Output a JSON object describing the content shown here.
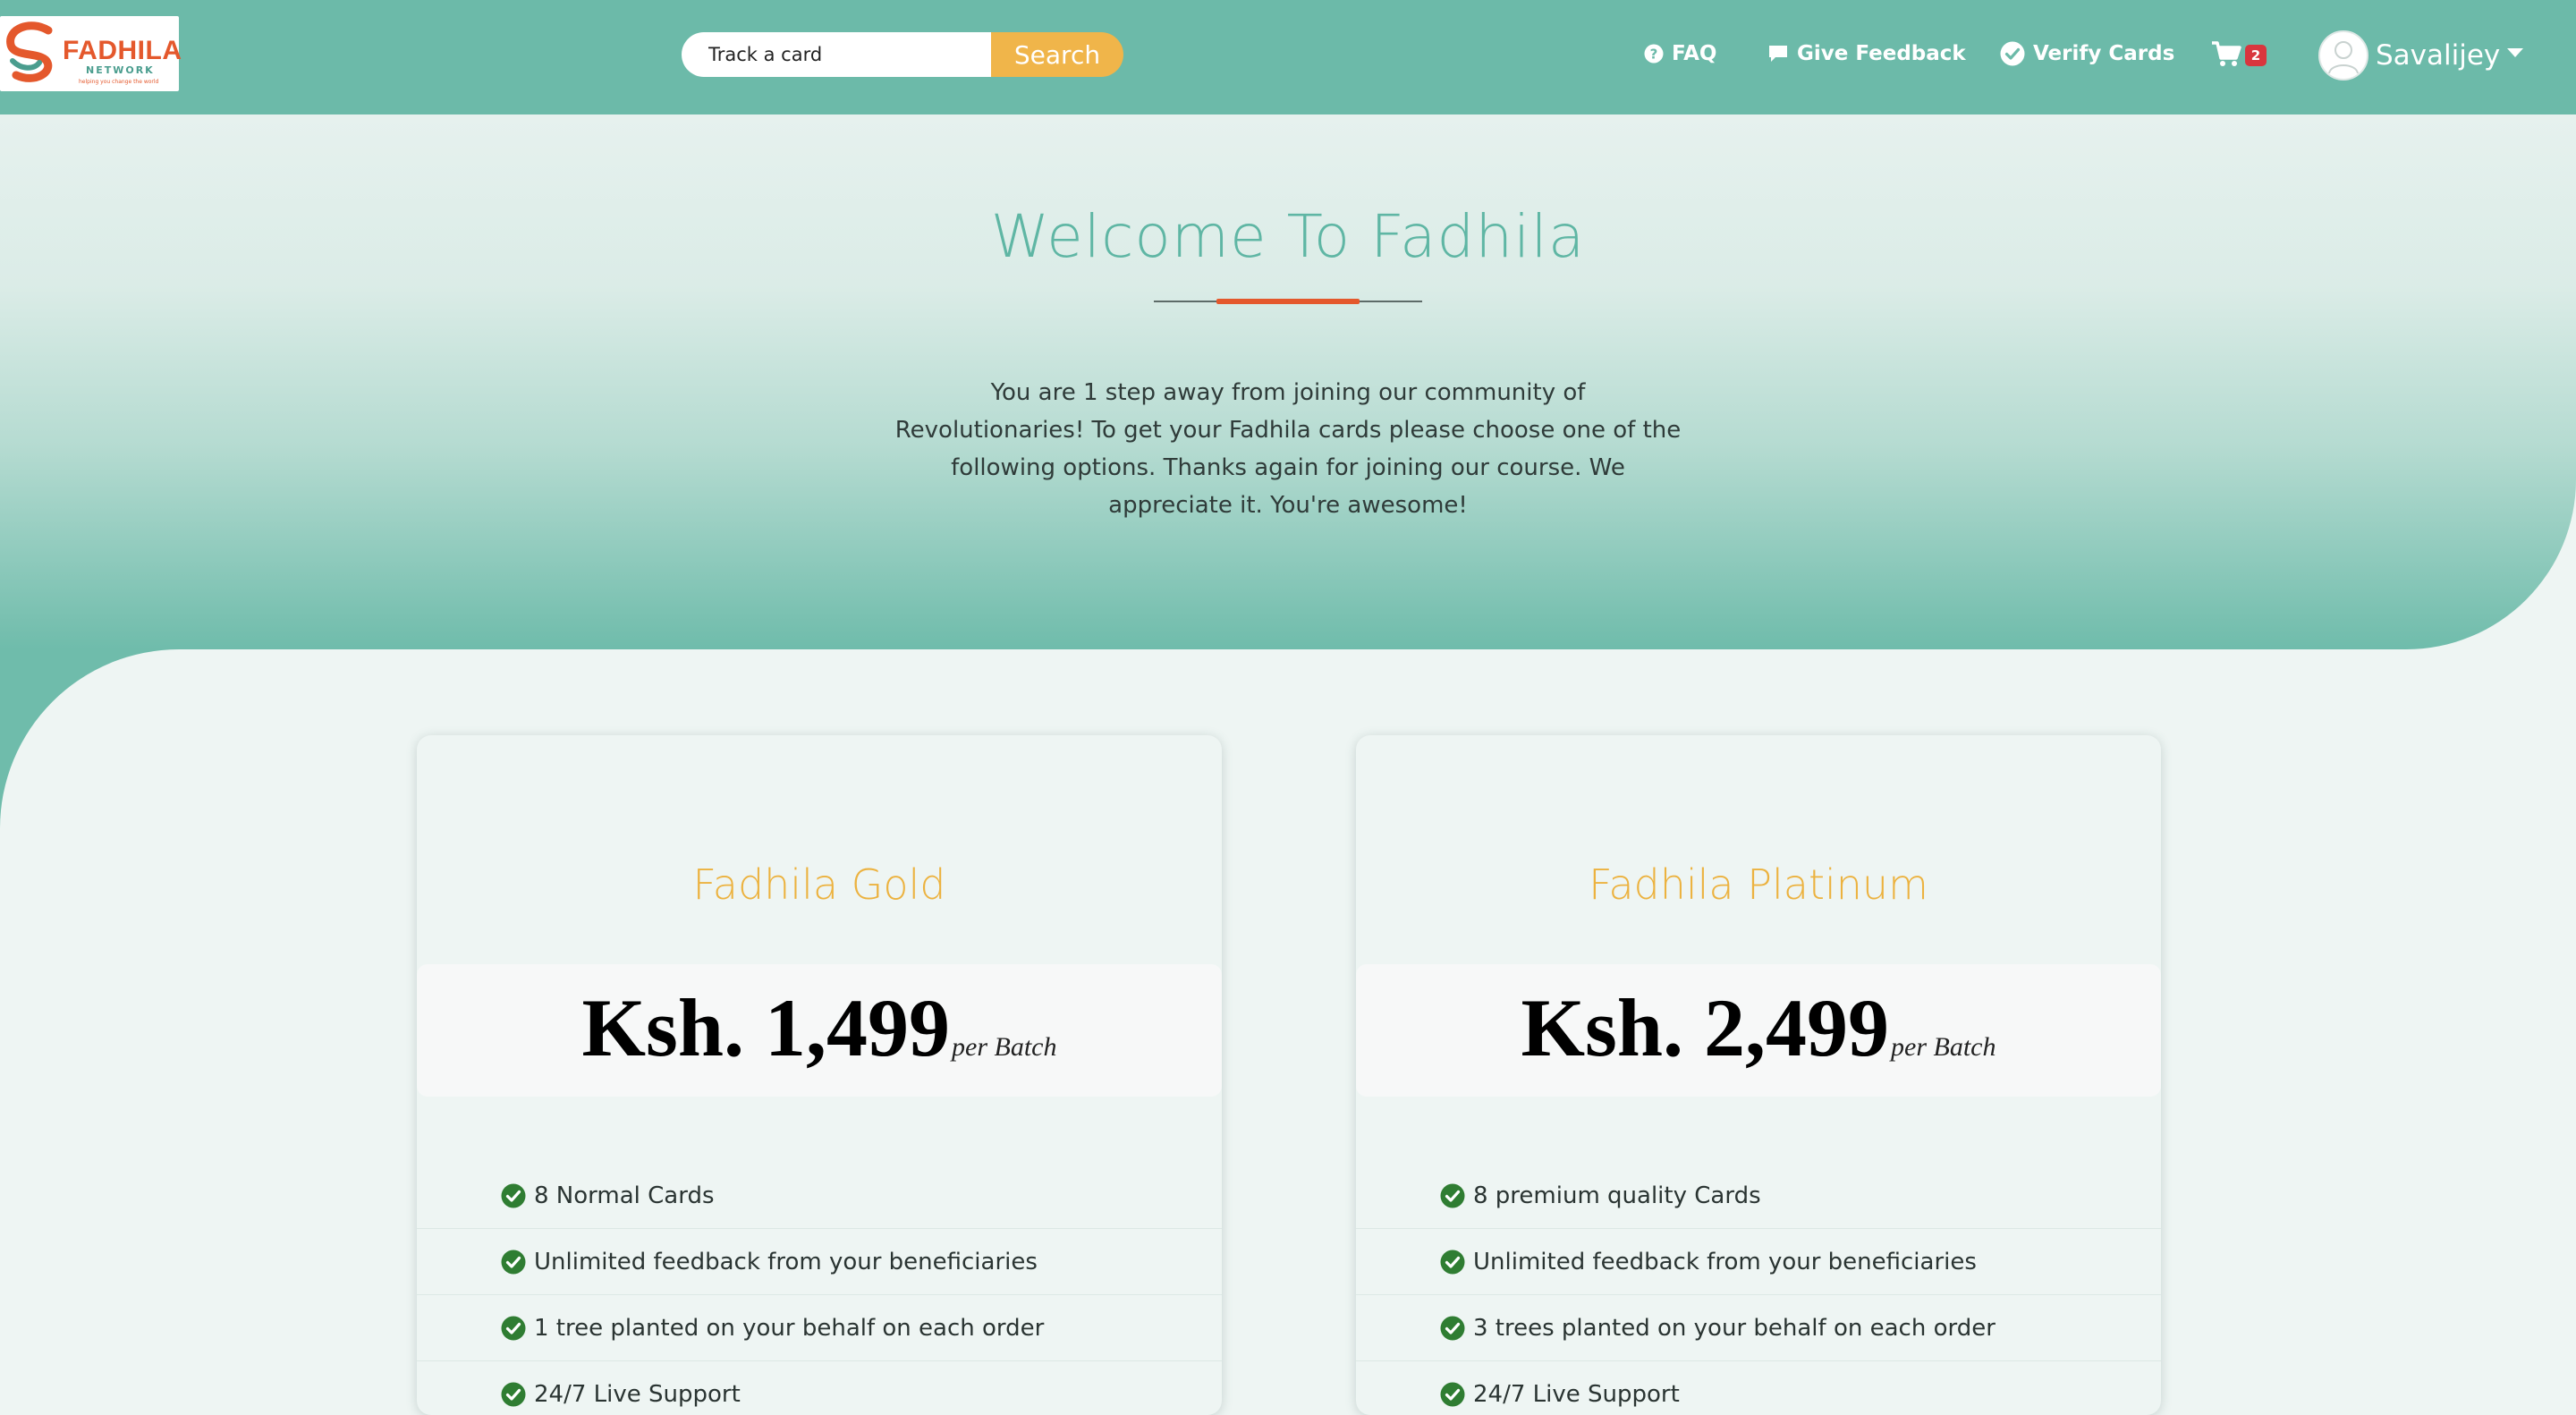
{
  "navbar": {
    "logo": {
      "word": "FADHILA",
      "sub": "NETWORK",
      "tagline": "helping you change the world"
    },
    "search": {
      "placeholder": "Track a card",
      "button_label": "Search"
    },
    "links": [
      {
        "label": "FAQ",
        "icon": "question-circle-icon"
      },
      {
        "label": "Give Feedback",
        "icon": "comment-icon"
      },
      {
        "label": "Verify Cards",
        "icon": "check-circle-icon"
      }
    ],
    "cart": {
      "icon": "cart-icon",
      "count": "2"
    },
    "user": {
      "name": "Savalijey",
      "icon": "user-avatar-icon"
    }
  },
  "hero": {
    "title": "Welcome To Fadhila",
    "paragraph": "You are 1 step away from joining our community of Revolutionaries! To get your Fadhila cards please choose one of the following options. Thanks again for joining our course. We appreciate it. You're awesome!"
  },
  "plans": [
    {
      "name": "Fadhila Gold",
      "price": "Ksh. 1,499",
      "unit": "per Batch",
      "features": [
        "8 Normal Cards",
        "Unlimited feedback from your beneficiaries",
        "1 tree planted on your behalf on each order",
        "24/7 Live Support"
      ]
    },
    {
      "name": "Fadhila Platinum",
      "price": "Ksh. 2,499",
      "unit": "per Batch",
      "features": [
        "8 premium quality Cards",
        "Unlimited feedback from your beneficiaries",
        "3 trees planted on your behalf on each order",
        "24/7 Live Support"
      ]
    }
  ],
  "colors": {
    "navbar": "#6cbaa9",
    "search_button": "#f0b54a",
    "accent_orange": "#e4582c",
    "plan_title": "#ecb23f",
    "check_green": "#2f7d32",
    "cart_badge": "#d9363e"
  }
}
